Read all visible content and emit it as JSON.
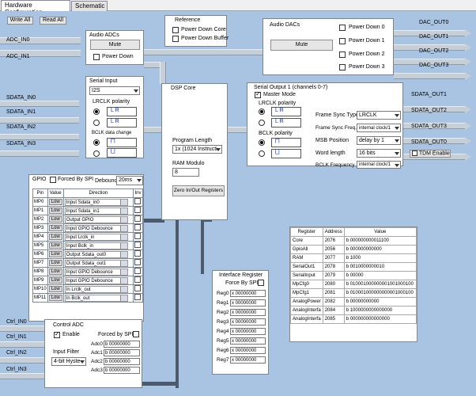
{
  "tabs": [
    "Hardware Configuration",
    "Schematic"
  ],
  "toolbar": {
    "write_all": "Write All",
    "read_all": "Read All"
  },
  "inputs": {
    "adc": [
      "ADC_IN0",
      "ADC_IN1"
    ],
    "sdata": [
      "SDATA_IN0",
      "SDATA_IN1",
      "SDATA_IN2",
      "SDATA_IN3"
    ],
    "ctrl": [
      "Ctrl_IN0",
      "Ctrl_IN1",
      "Ctrl_IN2",
      "Ctrl_IN3"
    ]
  },
  "outputs": {
    "dac": [
      "DAC_OUT0",
      "DAC_OUT1",
      "DAC_OUT2",
      "DAC_OUT3"
    ],
    "sdata": [
      "SDATA_OUT1",
      "SDATA_OUT2",
      "SDATA_OUT3",
      "SDATA_OUT0"
    ],
    "tdm_enable": "TDM Enable"
  },
  "reference": {
    "title": "Reference",
    "power_down_core": "Power Down Core",
    "power_down_buffer": "Power Down Buffer"
  },
  "audio_adcs": {
    "title": "Audio ADCs",
    "mute": "Mute",
    "power_down": "Power Down"
  },
  "audio_dacs": {
    "title": "Audio DACs",
    "mute": "Mute",
    "power_downs": [
      "Power Down 0",
      "Power Down 1",
      "Power Down 2",
      "Power Down 3"
    ]
  },
  "serial_input": {
    "title": "Serial Input",
    "format": "I2S",
    "lrclk_polarity": "LRCLK polarity",
    "bclk_edge": "BCLK data change"
  },
  "dsp": {
    "title": "DSP Core",
    "program_length_label": "Program Length",
    "program_length": "1x (1024 Instructi",
    "ram_modulo_label": "RAM Modulo",
    "ram_modulo": "8",
    "zero_button": "Zero In/Out Registers"
  },
  "serial_output": {
    "title": "Serial Output 1 (channels 0-7)",
    "master_mode": "Master Mode",
    "master_checked": true,
    "lrclk_polarity": "LRCLK polarity",
    "bclk_polarity": "BCLK polarity",
    "frame_sync_type_label": "Frame Sync Type",
    "frame_sync_type": "LRCLK",
    "frame_sync_freq_label": "Frame Sync Freq.",
    "frame_sync_freq": "internal clock/1",
    "msb_position_label": "MSB Position",
    "msb_position": "delay by 1",
    "word_length_label": "Word length",
    "word_length": "16 bits",
    "bclk_freq_label": "BCLK Frequency",
    "bclk_freq": "internal clock/1"
  },
  "gpio": {
    "title": "GPIO",
    "forced_by_spi": "Forced By SPI",
    "debounce_label": "Debounce",
    "debounce": "20ms",
    "columns": [
      "Pin",
      "Value",
      "Direction",
      "Inv"
    ],
    "rows": [
      {
        "pin": "MP0",
        "value": "Low",
        "dir": "Input Sdata_in0"
      },
      {
        "pin": "MP1",
        "value": "Low",
        "dir": "Input Sdata_in1"
      },
      {
        "pin": "MP2",
        "value": "Low",
        "dir": "Output GPIO"
      },
      {
        "pin": "MP3",
        "value": "Low",
        "dir": "Input GPIO Debounce"
      },
      {
        "pin": "MP4",
        "value": "Low",
        "dir": "Input Lrclk_in"
      },
      {
        "pin": "MP5",
        "value": "Low",
        "dir": "Input Bclk_in"
      },
      {
        "pin": "MP6",
        "value": "Low",
        "dir": "Output Sdata_out0"
      },
      {
        "pin": "MP7",
        "value": "Low",
        "dir": "Output Sdata_out1"
      },
      {
        "pin": "MP8",
        "value": "Low",
        "dir": "Input GPIO Debounce"
      },
      {
        "pin": "MP9",
        "value": "Low",
        "dir": "Input GPIO Debounce"
      },
      {
        "pin": "MP10",
        "value": "Low",
        "dir": "In Lrclk_out"
      },
      {
        "pin": "MP11",
        "value": "Low",
        "dir": "In Bclk_out"
      }
    ]
  },
  "interface": {
    "title": "Interface Register",
    "forced_by_spi": "Force By SPI",
    "regs": [
      {
        "n": "Reg0",
        "v": "x 00000000"
      },
      {
        "n": "Reg1",
        "v": "x 00000000"
      },
      {
        "n": "Reg2",
        "v": "x 00000000"
      },
      {
        "n": "Reg3",
        "v": "x 00000000"
      },
      {
        "n": "Reg4",
        "v": "x 00000000"
      },
      {
        "n": "Reg5",
        "v": "x 00000000"
      },
      {
        "n": "Reg6",
        "v": "x 00000000"
      },
      {
        "n": "Reg7",
        "v": "x 00000000"
      }
    ]
  },
  "register_table": {
    "columns": [
      "Register",
      "Address",
      "Value"
    ],
    "rows": [
      {
        "r": "Core",
        "a": "2076",
        "v": "b 000000000011100"
      },
      {
        "r": "GpioAll",
        "a": "2056",
        "v": "b 000000000000"
      },
      {
        "r": "RAM",
        "a": "2077",
        "v": "b 1000"
      },
      {
        "r": "SerialOut1",
        "a": "2078",
        "v": "b 0010000000010"
      },
      {
        "r": "SerialInput",
        "a": "2079",
        "v": "b 00000"
      },
      {
        "r": "MpCfg0",
        "a": "2080",
        "v": "b 010001000000001001000100"
      },
      {
        "r": "MpCfg1",
        "a": "2081",
        "v": "b 010001000000000001000100"
      },
      {
        "r": "AnalogPower",
        "a": "2082",
        "v": "b 00000000000"
      },
      {
        "r": "AnalogInterfa",
        "a": "2084",
        "v": "b 1000000000000000"
      },
      {
        "r": "AnalogInterfa",
        "a": "2085",
        "v": "b 000000000000000"
      }
    ]
  },
  "control_adc": {
    "title": "Control ADC",
    "enable": "Enable",
    "forced_by_spi": "Forced by SPI",
    "input_filter_label": "Input Filter",
    "input_filter": "4-bit Hyste",
    "adcs": [
      {
        "n": "Adc0",
        "v": "b 00000000"
      },
      {
        "n": "Adc1",
        "v": "b 00000000"
      },
      {
        "n": "Adc2",
        "v": "b 00000000"
      },
      {
        "n": "Adc3",
        "v": "b 00000000"
      }
    ]
  },
  "glyphs": {
    "lr": "L R",
    "lr_inv": "L R",
    "bclk": "⨅",
    "bclk_inv": "⨆"
  }
}
